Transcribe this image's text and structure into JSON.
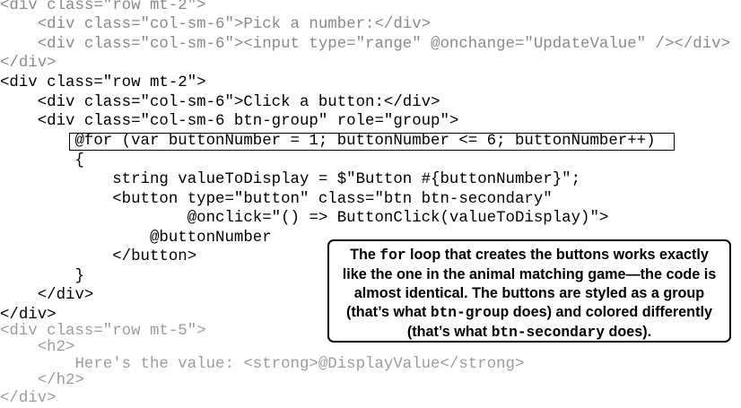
{
  "code_lines": [
    "<div class=\"row mt-2\">",
    "    <div class=\"col-sm-6\">Pick a number:</div>",
    "    <div class=\"col-sm-6\"><input type=\"range\" @onchange=\"UpdateValue\" /></div>",
    "</div>",
    "<div class=\"row mt-2\">",
    "    <div class=\"col-sm-6\">Click a button:</div>",
    "    <div class=\"col-sm-6 btn-group\" role=\"group\">",
    "        @for (var buttonNumber = 1; buttonNumber <= 6; buttonNumber++)",
    "        {",
    "            string valueToDisplay = $\"Button #{buttonNumber}\";",
    "            <button type=\"button\" class=\"btn btn-secondary\"",
    "                    @onclick=\"() => ButtonClick(valueToDisplay)\">",
    "                @buttonNumber",
    "            </button>",
    "        }",
    "    </div>",
    "</div>",
    "<div class=\"row mt-5\">",
    "    <h2>",
    "        Here's the value: <strong>@DisplayValue</strong>",
    "    </h2>",
    "</div>"
  ],
  "callout": {
    "t1": "The ",
    "t2": "for",
    "t3": " loop that creates the buttons works exactly like the one in the animal matching game—the code is almost identical. The buttons are styled as a group (that’s what ",
    "t4": "btn-group",
    "t5": " does) and colored differently (that’s what ",
    "t6": "btn-secondary",
    "t7": " does)."
  }
}
